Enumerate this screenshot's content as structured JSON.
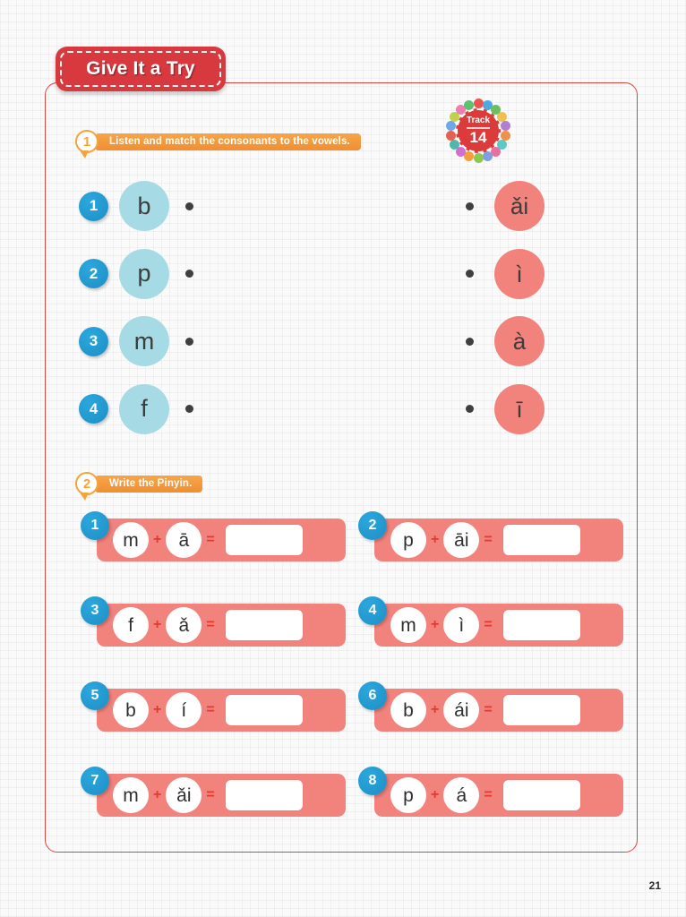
{
  "page": {
    "title": "Give It a Try",
    "number": "21",
    "frame_color": "#d8453f",
    "banner_color": "#d8393f"
  },
  "track": {
    "label": "Track",
    "number": "14",
    "core_color": "#dc3b3b",
    "bead_colors": [
      "#e8554f",
      "#4fa8e0",
      "#6bbf5e",
      "#f0c04a",
      "#b07fd0",
      "#ef8f48",
      "#5ec8c4",
      "#e86fa0",
      "#7f9fe0",
      "#8cc94f",
      "#f2a03c",
      "#d06fd0",
      "#4fb8a8",
      "#e8604f",
      "#6fa8e8",
      "#c0d04f",
      "#ef7fb0",
      "#5fc070"
    ]
  },
  "sections": [
    {
      "number": "1",
      "instruction": "Listen and match the consonants to the vowels."
    },
    {
      "number": "2",
      "instruction": "Write the Pinyin."
    }
  ],
  "matching": {
    "consonants": [
      {
        "number": "1",
        "letter": "b"
      },
      {
        "number": "2",
        "letter": "p"
      },
      {
        "number": "3",
        "letter": "m"
      },
      {
        "number": "4",
        "letter": "f"
      }
    ],
    "vowels": [
      {
        "letter": "ǎi"
      },
      {
        "letter": "ì"
      },
      {
        "letter": "à"
      },
      {
        "letter": "ī"
      }
    ],
    "consonant_circle_color": "#a6dbe6",
    "vowel_circle_color": "#f2827c"
  },
  "writing": {
    "plus": "+",
    "equals": "=",
    "items": [
      {
        "number": "1",
        "consonant": "m",
        "vowel": "ā",
        "answer": ""
      },
      {
        "number": "2",
        "consonant": "p",
        "vowel": "āi",
        "answer": ""
      },
      {
        "number": "3",
        "consonant": "f",
        "vowel": "ǎ",
        "answer": ""
      },
      {
        "number": "4",
        "consonant": "m",
        "vowel": "ì",
        "answer": ""
      },
      {
        "number": "5",
        "consonant": "b",
        "vowel": "í",
        "answer": ""
      },
      {
        "number": "6",
        "consonant": "b",
        "vowel": "ái",
        "answer": ""
      },
      {
        "number": "7",
        "consonant": "m",
        "vowel": "ǎi",
        "answer": ""
      },
      {
        "number": "8",
        "consonant": "p",
        "vowel": "á",
        "answer": ""
      }
    ]
  }
}
